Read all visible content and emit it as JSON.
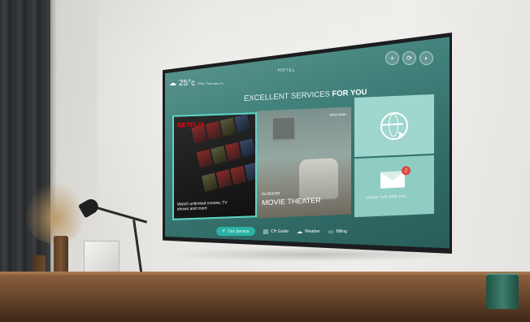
{
  "tv": {
    "hotel_label": "HOTEL",
    "weather": {
      "icon": "cloud-icon",
      "temperature": "25°c",
      "date": "Wed, February 01"
    },
    "headline": {
      "prefix": "EXCELLENT SERVICES",
      "emphasis": "FOR YOU"
    },
    "top_icons": [
      "add-icon",
      "settings-icon",
      "globe-icon"
    ],
    "tiles": {
      "netflix": {
        "logo": "NETFLIX",
        "text": "Watch unlimited movies, TV shows and more"
      },
      "movie_theater": {
        "small": "IN-ROOM",
        "title": "MOVIE THEATER",
        "badge": "Smart Apps"
      },
      "web": {
        "icon": "globe-icon"
      },
      "mail": {
        "count": "2",
        "text": "CHECK THE NEW MAIL"
      }
    },
    "menu": [
      {
        "icon": "plus-icon",
        "label": "Our Service"
      },
      {
        "icon": "tv-guide-icon",
        "label": "CH Guide"
      },
      {
        "icon": "weather-icon",
        "label": "Weather"
      },
      {
        "icon": "billing-icon",
        "label": "Billing"
      }
    ]
  }
}
